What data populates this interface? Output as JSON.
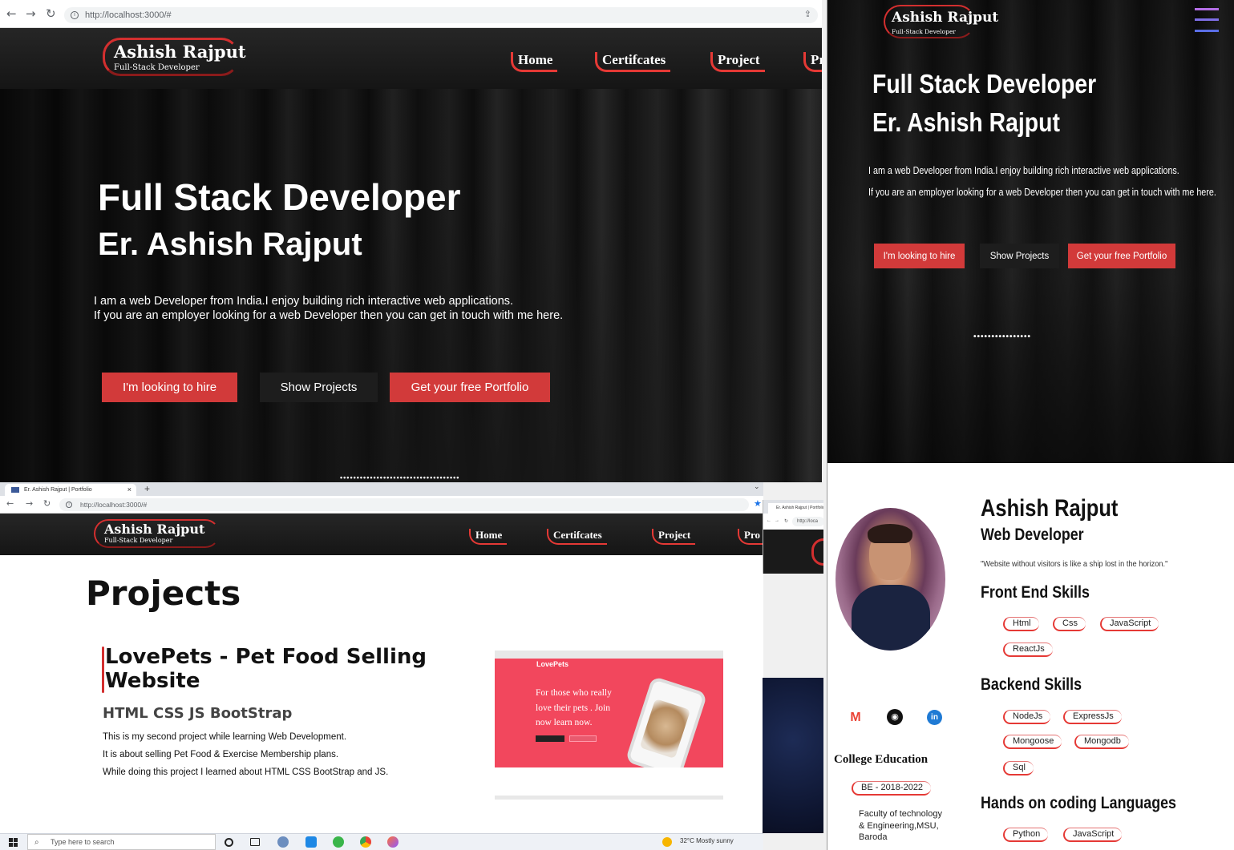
{
  "browser": {
    "url": "http://localhost:3000/#",
    "tab_title": "Er. Ashish Rajput | Portfolio",
    "small_tab_title": "Er. Ashish Rajput | Portfolio",
    "small_url": "http://loca"
  },
  "site": {
    "logo_title": "Ashish Rajput",
    "logo_subtitle": "Full-Stack Developer",
    "nav": [
      "Home",
      "Certifcates",
      "Project",
      "Pr"
    ],
    "nav_b": [
      "Home",
      "Certifcates",
      "Project",
      "Pro"
    ]
  },
  "hero": {
    "title": "Full Stack Developer",
    "name": "Er. Ashish Rajput",
    "line1": "I am a web Developer from India.I enjoy building rich interactive web applications.",
    "line2": "If you are an employer looking for a web Developer then you can get in touch with me here.",
    "btn_hire": "I'm looking to hire",
    "btn_projects": "Show Projects",
    "btn_portfolio": "Get your free Portfolio",
    "dots": "••••••••••••••••••••••••••••••••••••",
    "dots_mobile": "••••••••••••••••"
  },
  "projects": {
    "heading": "Projects",
    "item_title": "LovePets - Pet Food Selling Website",
    "tech": "HTML CSS JS BootStrap",
    "lines": [
      "This is my second project while learning Web Development.",
      "It is about selling Pet Food & Exercise Membership plans.",
      "While doing this project I learned about HTML CSS BootStrap and JS."
    ],
    "shot_brand": "LovePets",
    "shot_text": "For those who really love their pets . Join now learn now."
  },
  "about": {
    "name": "Ashish Rajput",
    "role": "Web Developer",
    "quote": "\"Website without visitors is like a ship lost in the horizon.\"",
    "frontend_head": "Front End Skills",
    "frontend": [
      "Html",
      "Css",
      "JavaScript",
      "ReactJs"
    ],
    "backend_head": "Backend Skills",
    "backend": [
      "NodeJs",
      "ExpressJs",
      "Mongoose",
      "Mongodb",
      "Sql"
    ],
    "coding_head": "Hands on coding Languages",
    "coding": [
      "Python",
      "JavaScript"
    ],
    "edu_head": "College Education",
    "edu_badge": "BE - 2018-2022",
    "edu_college": "Faculty of technology & Engineering,MSU, Baroda"
  },
  "taskbar": {
    "search_placeholder": "Type here to search",
    "weather": "32°C  Mostly sunny"
  },
  "colors": {
    "accent": "#d23a3a",
    "nav_bg": "#1c1c1c",
    "shot_pink": "#f2475d"
  }
}
